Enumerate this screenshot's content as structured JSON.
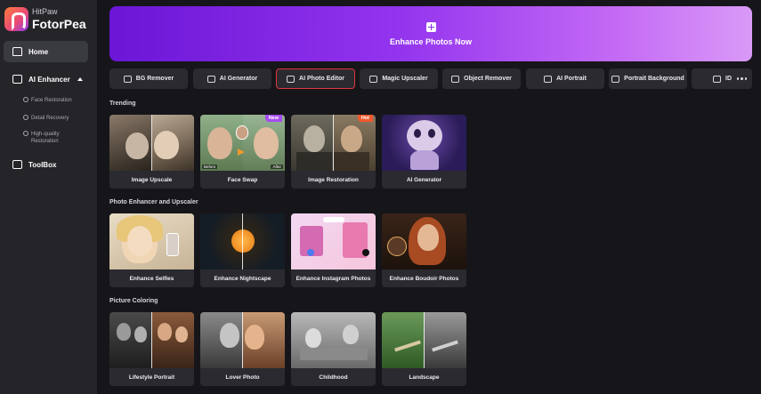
{
  "brand": {
    "sub": "HitPaw",
    "name": "FotorPea"
  },
  "sidebar": {
    "home": "Home",
    "ai_enhancer": "AI Enhancer",
    "sub_items": [
      "Face Restoration",
      "Detail Recovery",
      "High-quality Restoration"
    ],
    "toolbox": "ToolBox"
  },
  "hero": {
    "label": "Enhance Photos Now"
  },
  "tools": [
    {
      "label": "BG Remover",
      "icon": "bg-remover-icon"
    },
    {
      "label": "AI Generator",
      "icon": "wand-icon"
    },
    {
      "label": "AI Photo Editor",
      "icon": "photo-edit-icon",
      "active": true
    },
    {
      "label": "Magic Upscaler",
      "icon": "expand-icon"
    },
    {
      "label": "Object Remover",
      "icon": "eraser-icon"
    },
    {
      "label": "AI Portrait",
      "icon": "portrait-icon"
    },
    {
      "label": "Portrait Background",
      "icon": "portrait-bg-icon"
    },
    {
      "label": "ID",
      "icon": "id-scan-icon"
    }
  ],
  "sections": {
    "trending": {
      "title": "Trending",
      "cards": [
        {
          "label": "Image Upscale"
        },
        {
          "label": "Face Swap",
          "badge": "New",
          "before": "Before",
          "after": "After"
        },
        {
          "label": "Image Restoration",
          "badge": "Hot"
        },
        {
          "label": "AI Generator"
        }
      ]
    },
    "enhancer": {
      "title": "Photo Enhancer and Upscaler",
      "cards": [
        {
          "label": "Enhance Selfies"
        },
        {
          "label": "Enhance Nightscape"
        },
        {
          "label": "Enhance Instagram Photos"
        },
        {
          "label": "Enhance Boudoir Photos"
        }
      ]
    },
    "coloring": {
      "title": "Picture Coloring",
      "cards": [
        {
          "label": "Lifestyle Portrait"
        },
        {
          "label": "Lover Photo"
        },
        {
          "label": "Childhood"
        },
        {
          "label": "Landscape"
        }
      ]
    }
  },
  "colors": {
    "accent": "#9334ee",
    "active_border": "#e0343c",
    "bg": "#16161a",
    "sidebar": "#242429"
  }
}
